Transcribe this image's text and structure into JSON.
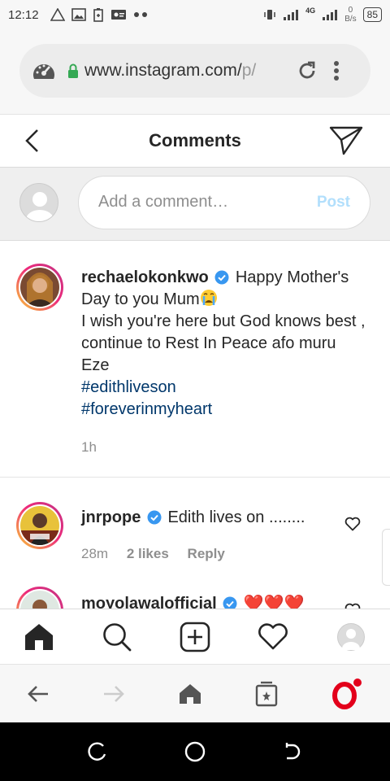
{
  "status_bar": {
    "time": "12:12",
    "network": "4G",
    "speed_value": "0",
    "speed_unit": "B/s",
    "battery": "85"
  },
  "browser": {
    "url_main": "www.instagram.com/",
    "url_fade": "p/",
    "url_icon": "speedometer-icon"
  },
  "header": {
    "title": "Comments"
  },
  "add_comment": {
    "placeholder": "Add a comment…",
    "post_label": "Post"
  },
  "comments": [
    {
      "username": "rechaelokonkwo",
      "text_line1": "Happy Mother's Day to you Mum",
      "text_line2": "I wish you're here but God knows best , continue to Rest In Peace afo muru Eze",
      "hashtags": [
        "#edithliveson",
        "#foreverinmyheart"
      ],
      "time": "1h"
    },
    {
      "username": "jnrpope",
      "text": "Edith lives on ........",
      "time": "28m",
      "likes": "2 likes",
      "reply_label": "Reply"
    },
    {
      "username": "moyolawalofficial",
      "text": "❤️❤️❤️"
    }
  ],
  "colors": {
    "link": "#00376b",
    "post_disabled": "#b2dffc",
    "verified": "#3897f0",
    "opera_red": "#e3001b"
  }
}
